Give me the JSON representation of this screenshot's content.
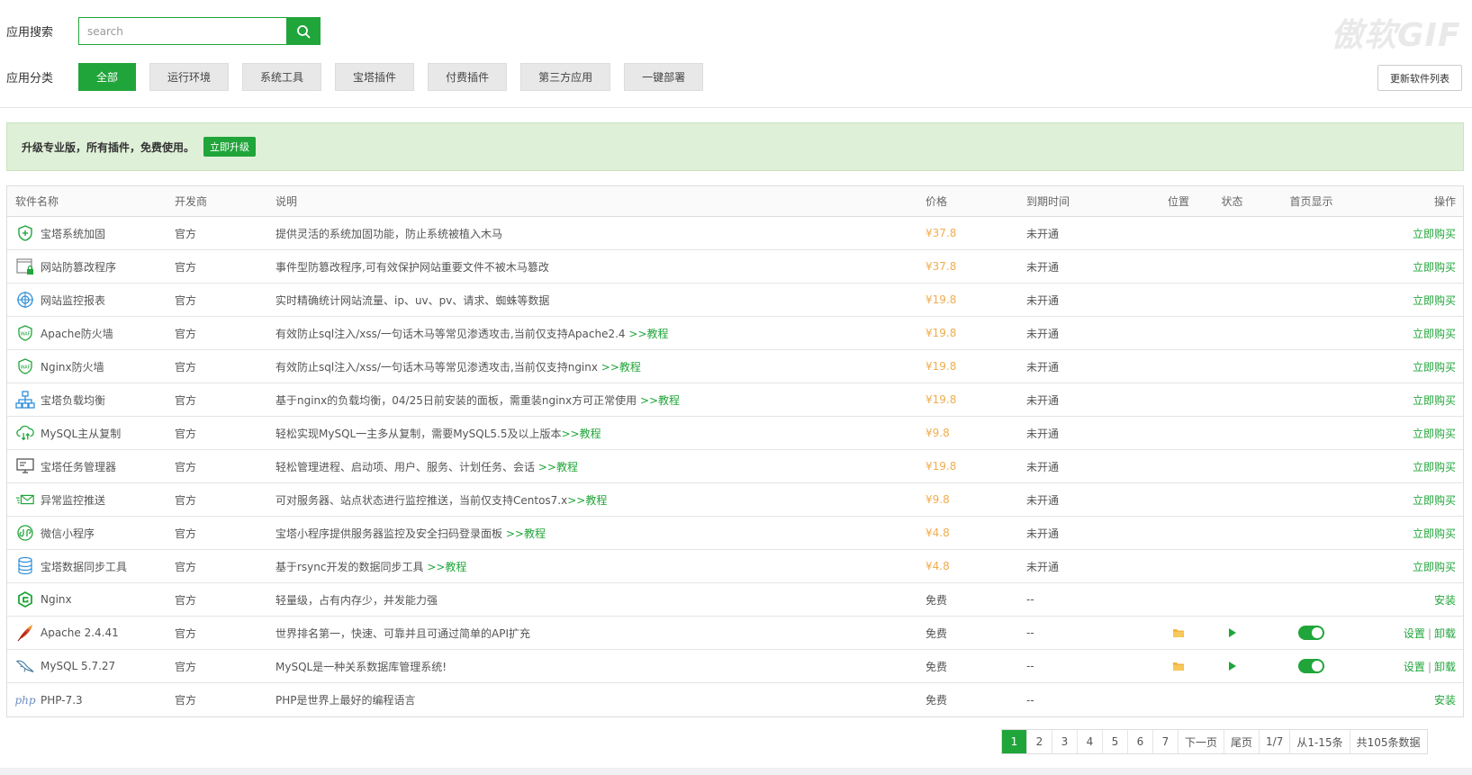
{
  "watermark": "傲软GIF",
  "search": {
    "label": "应用搜索",
    "placeholder": "search"
  },
  "categories": {
    "label": "应用分类",
    "items": [
      "全部",
      "运行环境",
      "系统工具",
      "宝塔插件",
      "付费插件",
      "第三方应用",
      "一键部署"
    ],
    "active_index": 0
  },
  "update_button": "更新软件列表",
  "banner": {
    "text": "升级专业版，所有插件，免费使用。",
    "button": "立即升级"
  },
  "colors": {
    "accent": "#20a53a",
    "price": "#f0ad4e",
    "banner_bg": "#dff0d8"
  },
  "table": {
    "headers": [
      "软件名称",
      "开发商",
      "说明",
      "价格",
      "到期时间",
      "位置",
      "状态",
      "首页显示",
      "操作"
    ],
    "rows": [
      {
        "icon": "shield-plus-icon",
        "name": "宝塔系统加固",
        "dev": "官方",
        "desc": "提供灵活的系统加固功能，防止系统被植入木马",
        "tutorial": "",
        "price": "¥37.8",
        "paid": true,
        "expire": "未开通",
        "ops": [
          "立即购买"
        ]
      },
      {
        "icon": "window-lock-icon",
        "name": "网站防篡改程序",
        "dev": "官方",
        "desc": "事件型防篡改程序,可有效保护网站重要文件不被木马篡改",
        "tutorial": "",
        "price": "¥37.8",
        "paid": true,
        "expire": "未开通",
        "ops": [
          "立即购买"
        ]
      },
      {
        "icon": "globe-target-icon",
        "name": "网站监控报表",
        "dev": "官方",
        "desc": "实时精确统计网站流量、ip、uv、pv、请求、蜘蛛等数据",
        "tutorial": "",
        "price": "¥19.8",
        "paid": true,
        "expire": "未开通",
        "ops": [
          "立即购买"
        ]
      },
      {
        "icon": "waf-shield-icon",
        "name": "Apache防火墙",
        "dev": "官方",
        "desc": "有效防止sql注入/xss/一句话木马等常见渗透攻击,当前仅支持Apache2.4 ",
        "tutorial": ">>教程",
        "price": "¥19.8",
        "paid": true,
        "expire": "未开通",
        "ops": [
          "立即购买"
        ]
      },
      {
        "icon": "waf-shield-icon",
        "name": "Nginx防火墙",
        "dev": "官方",
        "desc": "有效防止sql注入/xss/一句话木马等常见渗透攻击,当前仅支持nginx ",
        "tutorial": ">>教程",
        "price": "¥19.8",
        "paid": true,
        "expire": "未开通",
        "ops": [
          "立即购买"
        ]
      },
      {
        "icon": "network-tree-icon",
        "name": "宝塔负载均衡",
        "dev": "官方",
        "desc": "基于nginx的负载均衡，04/25日前安装的面板，需重装nginx方可正常使用 ",
        "tutorial": ">>教程",
        "price": "¥19.8",
        "paid": true,
        "expire": "未开通",
        "ops": [
          "立即购买"
        ]
      },
      {
        "icon": "cloud-sync-icon",
        "name": "MySQL主从复制",
        "dev": "官方",
        "desc": "轻松实现MySQL一主多从复制，需要MySQL5.5及以上版本",
        "tutorial": ">>教程",
        "price": "¥9.8",
        "paid": true,
        "expire": "未开通",
        "ops": [
          "立即购买"
        ]
      },
      {
        "icon": "monitor-tasks-icon",
        "name": "宝塔任务管理器",
        "dev": "官方",
        "desc": "轻松管理进程、启动项、用户、服务、计划任务、会话 ",
        "tutorial": ">>教程",
        "price": "¥19.8",
        "paid": true,
        "expire": "未开通",
        "ops": [
          "立即购买"
        ]
      },
      {
        "icon": "send-mail-icon",
        "name": "异常监控推送",
        "dev": "官方",
        "desc": "可对服务器、站点状态进行监控推送，当前仅支持Centos7.x",
        "tutorial": ">>教程",
        "price": "¥9.8",
        "paid": true,
        "expire": "未开通",
        "ops": [
          "立即购买"
        ]
      },
      {
        "icon": "wechat-mini-icon",
        "name": "微信小程序",
        "dev": "官方",
        "desc": "宝塔小程序提供服务器监控及安全扫码登录面板 ",
        "tutorial": ">>教程",
        "price": "¥4.8",
        "paid": true,
        "expire": "未开通",
        "ops": [
          "立即购买"
        ]
      },
      {
        "icon": "database-sync-icon",
        "name": "宝塔数据同步工具",
        "dev": "官方",
        "desc": "基于rsync开发的数据同步工具 ",
        "tutorial": ">>教程",
        "price": "¥4.8",
        "paid": true,
        "expire": "未开通",
        "ops": [
          "立即购买"
        ]
      },
      {
        "icon": "nginx-logo-icon",
        "name": "Nginx",
        "dev": "官方",
        "desc": "轻量级，占有内存少，并发能力强",
        "tutorial": "",
        "price": "免费",
        "paid": false,
        "expire": "--",
        "ops": [
          "安装"
        ]
      },
      {
        "icon": "apache-feather-icon",
        "name": "Apache 2.4.41",
        "dev": "官方",
        "desc": "世界排名第一，快速、可靠并且可通过简单的API扩充",
        "tutorial": "",
        "price": "免费",
        "paid": false,
        "expire": "--",
        "installed": true,
        "ops": [
          "设置",
          "卸载"
        ]
      },
      {
        "icon": "mysql-dolphin-icon",
        "name": "MySQL 5.7.27",
        "dev": "官方",
        "desc": "MySQL是一种关系数据库管理系统!",
        "tutorial": "",
        "price": "免费",
        "paid": false,
        "expire": "--",
        "installed": true,
        "ops": [
          "设置",
          "卸载"
        ]
      },
      {
        "icon": "php-logo-icon",
        "name": "PHP-7.3",
        "dev": "官方",
        "desc": "PHP是世界上最好的编程语言",
        "tutorial": "",
        "price": "免费",
        "paid": false,
        "expire": "--",
        "ops": [
          "安装"
        ]
      }
    ]
  },
  "icon_labels": {
    "php": "php"
  },
  "pagination": {
    "pages": [
      "1",
      "2",
      "3",
      "4",
      "5",
      "6",
      "7"
    ],
    "active": "1",
    "next": "下一页",
    "last": "尾页",
    "page_of": "1/7",
    "range": "从1-15条",
    "total": "共105条数据"
  }
}
